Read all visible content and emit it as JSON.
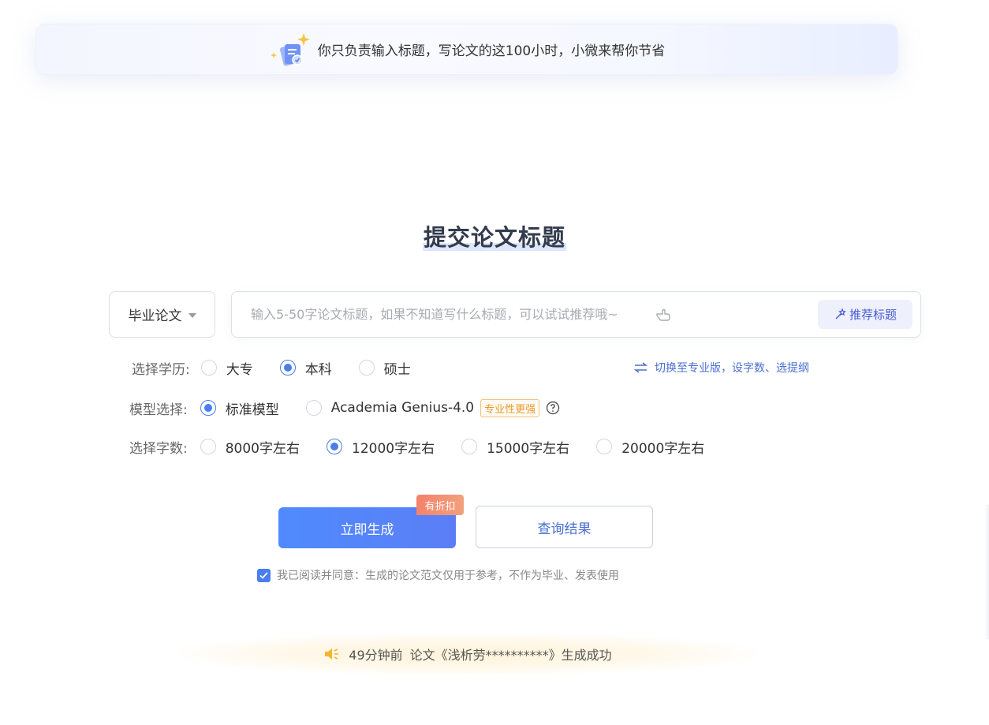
{
  "banner": {
    "text": "你只负责输入标题，写论文的这100小时，小微来帮你节省",
    "icon": "document-sparkle-icon"
  },
  "page_title": "提交论文标题",
  "paper_type": {
    "selected": "毕业论文",
    "icon": "chevron-down-icon"
  },
  "title_input": {
    "value": "",
    "placeholder": "输入5-50字论文标题，如果不知道写什么标题，可以试试推荐哦~",
    "hint_icon": "pointing-hand-icon",
    "recommend_label": "推荐标题",
    "recommend_icon": "magic-wand-icon"
  },
  "education": {
    "label": "选择学历:",
    "options": [
      "大专",
      "本科",
      "硕士"
    ],
    "selected": "本科"
  },
  "switch_link": {
    "label": "切换至专业版，设字数、选提纲",
    "icon": "swap-arrows-icon"
  },
  "model": {
    "label": "模型选择:",
    "options": [
      "标准模型",
      "Academia Genius-4.0"
    ],
    "selected": "标准模型",
    "pro_tag": "专业性更强",
    "help_icon": "question-circle-icon"
  },
  "word_count": {
    "label": "选择字数:",
    "options": [
      "8000字左右",
      "12000字左右",
      "15000字左右",
      "20000字左右"
    ],
    "selected": "12000字左右"
  },
  "actions": {
    "generate_label": "立即生成",
    "discount_badge": "有折扣",
    "query_label": "查询结果"
  },
  "agreement": {
    "checked": true,
    "text": "我已阅读并同意：生成的论文范文仅用于参考，不作为毕业、发表使用"
  },
  "notice": {
    "icon": "speaker-icon",
    "time": "49分钟前",
    "message": "论文《浅析劳**********》生成成功"
  },
  "colors": {
    "primary": "#4a7df0",
    "link": "#4a6fd1",
    "badge": "#f4826a",
    "pro_tag": "#e89a2c"
  }
}
